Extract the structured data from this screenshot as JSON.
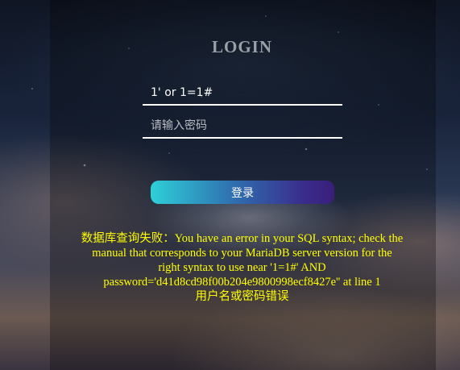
{
  "login": {
    "title": "LOGIN",
    "username_value": "1' or 1=1#",
    "password_placeholder": "请输入密码",
    "submit_label": "登录"
  },
  "result": {
    "error_message": "数据库查询失败：You have an error in your SQL syntax; check the manual that corresponds to your MariaDB server version for the right syntax to use near '1=1#' AND password='d41d8cd98f00b204e9800998ecf8427e'' at line 1",
    "auth_message": "用户名或密码错误"
  },
  "colors": {
    "message_text": "#ffff00",
    "button_gradient_start": "#2ed0d8",
    "button_gradient_end": "#3a1f7a"
  }
}
